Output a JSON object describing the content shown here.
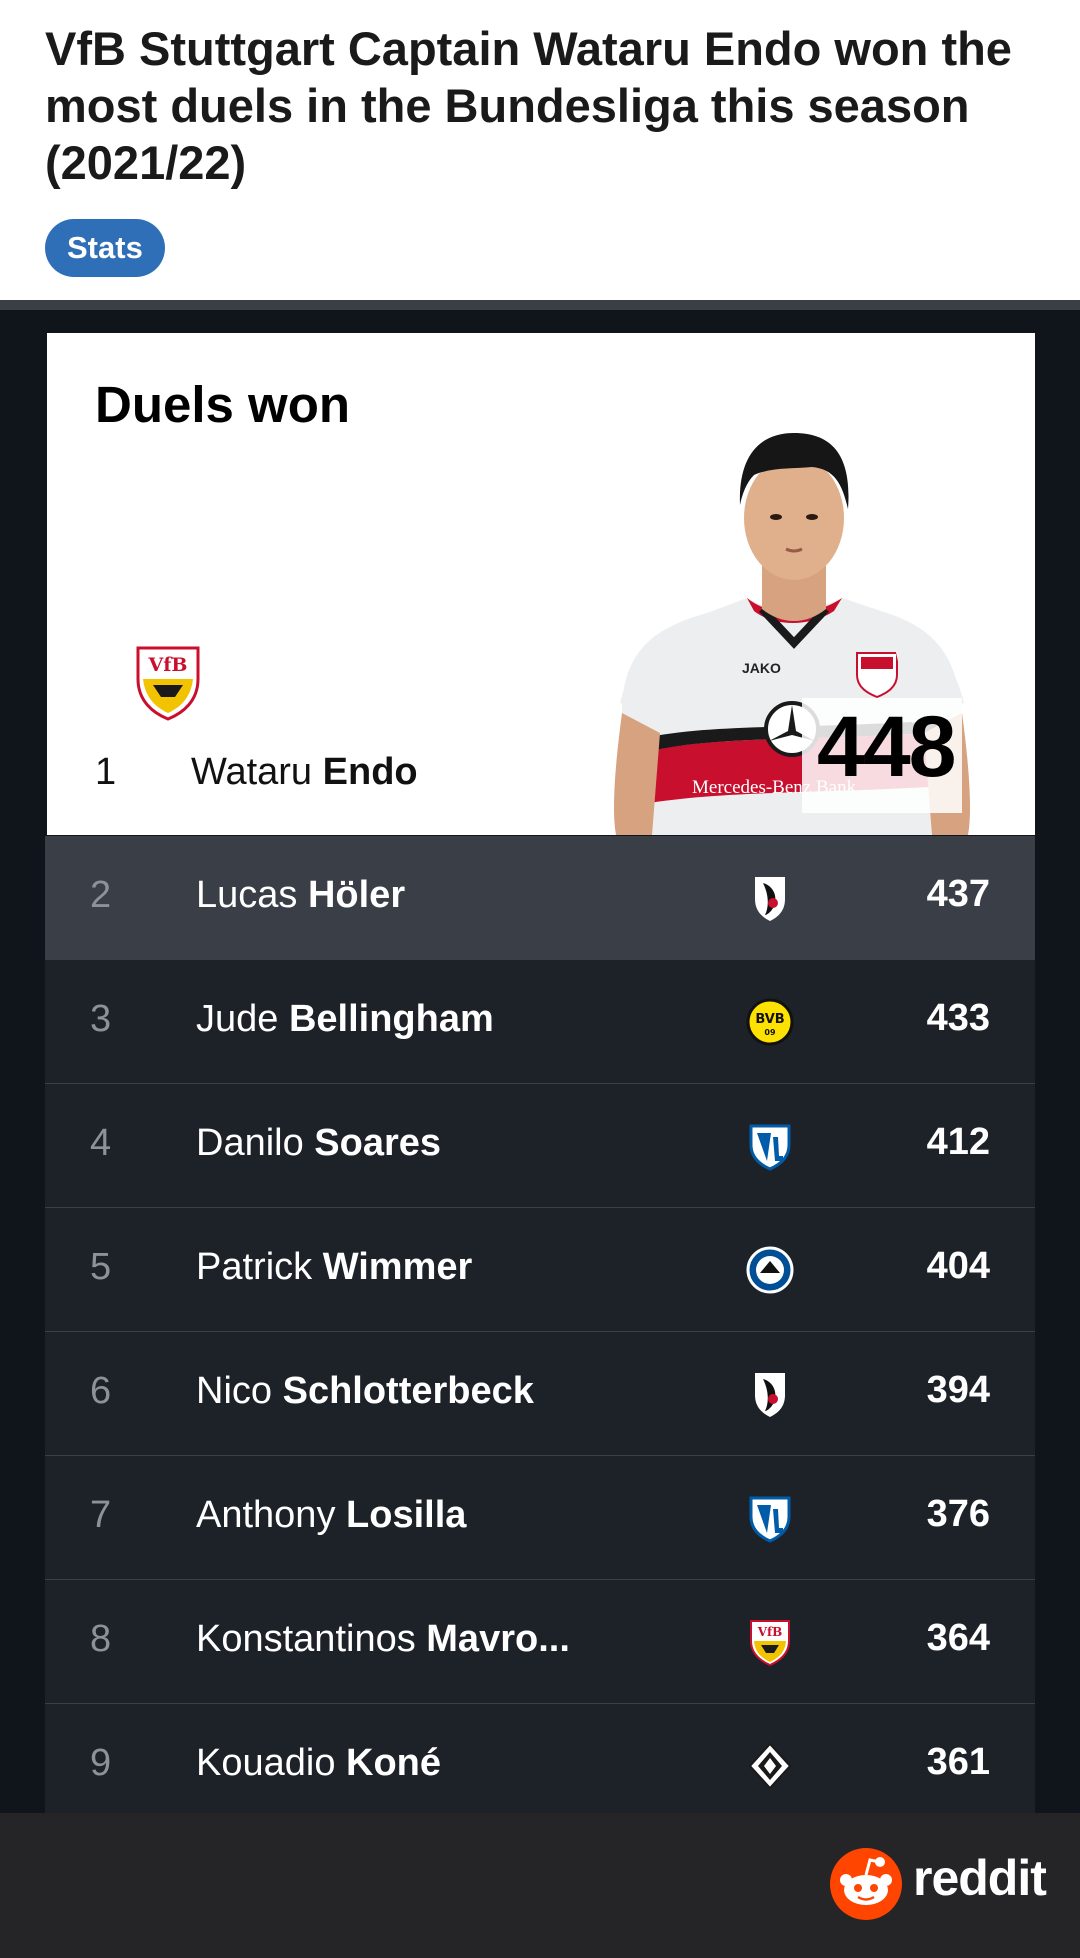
{
  "post": {
    "title": "VfB Stuttgart Captain Wataru Endo won the most duels in the Bundesliga this season (2021/22)",
    "flair": "Stats"
  },
  "card": {
    "title": "Duels won",
    "leader": {
      "rank": "1",
      "first_name": "Wataru",
      "last_name": "Endo",
      "value": "448",
      "club_icon": "vfb-stuttgart-crest-icon"
    }
  },
  "rows": [
    {
      "rank": "2",
      "first_name": "Lucas",
      "last_name": "Höler",
      "value": "437",
      "club_icon": "sc-freiburg-crest-icon"
    },
    {
      "rank": "3",
      "first_name": "Jude",
      "last_name": "Bellingham",
      "value": "433",
      "club_icon": "bvb-crest-icon"
    },
    {
      "rank": "4",
      "first_name": "Danilo",
      "last_name": "Soares",
      "value": "412",
      "club_icon": "vfl-bochum-crest-icon"
    },
    {
      "rank": "5",
      "first_name": "Patrick",
      "last_name": "Wimmer",
      "value": "404",
      "club_icon": "arminia-bielefeld-crest-icon"
    },
    {
      "rank": "6",
      "first_name": "Nico",
      "last_name": "Schlotterbeck",
      "value": "394",
      "club_icon": "sc-freiburg-crest-icon"
    },
    {
      "rank": "7",
      "first_name": "Anthony",
      "last_name": "Losilla",
      "value": "376",
      "club_icon": "vfl-bochum-crest-icon"
    },
    {
      "rank": "8",
      "first_name": "Konstantinos",
      "last_name": "Mavro...",
      "value": "364",
      "club_icon": "vfb-stuttgart-crest-icon"
    },
    {
      "rank": "9",
      "first_name": "Kouadio",
      "last_name": "Koné",
      "value": "361",
      "club_icon": "gladbach-crest-icon"
    }
  ],
  "footer": {
    "brand": "reddit",
    "brand_color": "#ff4500"
  },
  "colors": {
    "flair_bg": "#2f6fb7",
    "row_bg": "#1d2228",
    "row_highlight_bg": "#3a3f47"
  }
}
